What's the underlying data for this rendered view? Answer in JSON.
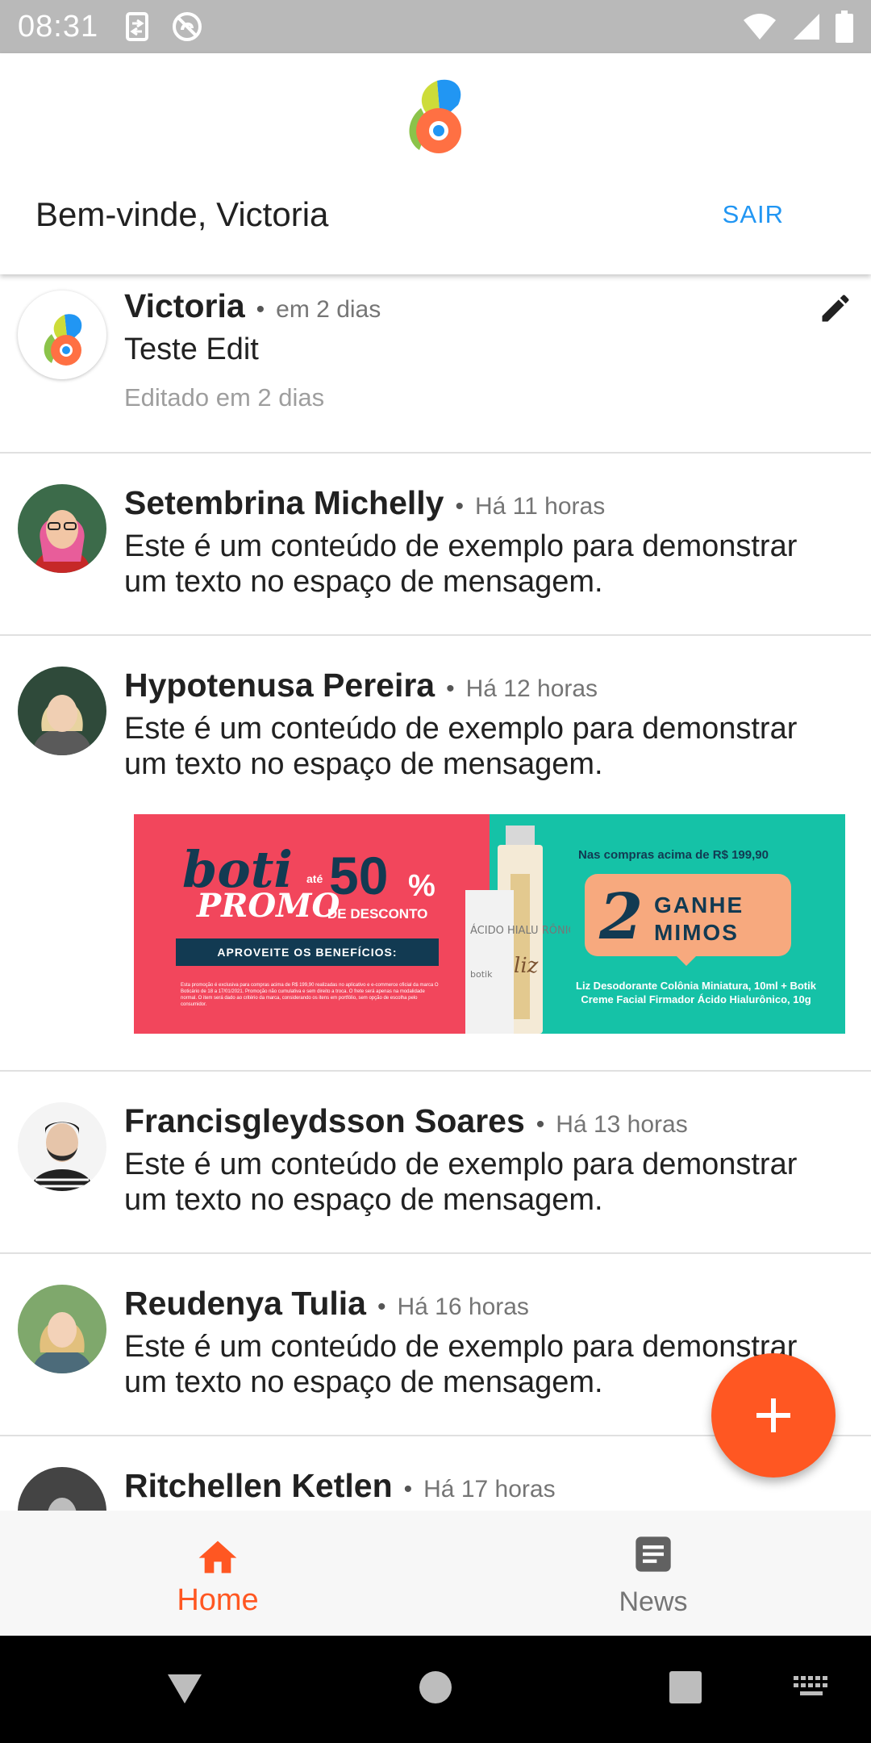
{
  "status_bar": {
    "time": "08:31"
  },
  "header": {
    "welcome": "Bem-vinde, Victoria",
    "logout_label": "SAIR"
  },
  "posts": [
    {
      "author": "Victoria",
      "time": "em 2 dias",
      "message": "Teste Edit",
      "edited": "Editado em 2 dias"
    },
    {
      "author": "Setembrina Michelly",
      "time": "Há 11 horas",
      "message": "Este é um conteúdo de exemplo para demonstrar um texto no espaço de mensagem."
    },
    {
      "author": "Hypotenusa Pereira",
      "time": "Há 12 horas",
      "message": "Este é um conteúdo de exemplo para demonstrar um texto no espaço de mensagem."
    },
    {
      "author": "Francisgleydsson Soares",
      "time": "Há 13 horas",
      "message": "Este é um conteúdo de exemplo para demonstrar um texto no espaço de mensagem."
    },
    {
      "author": "Reudenya Tulia",
      "time": "Há 16 horas",
      "message": "Este é um conteúdo de exemplo para demonstrar um texto no espaço de mensagem."
    },
    {
      "author": "Ritchellen Ketlen",
      "time": "Há 17 horas"
    }
  ],
  "banner": {
    "brand": "boti",
    "promo": "PROMO",
    "ate": "até",
    "discount": "50",
    "percent": "%",
    "desconto": "DE DESCONTO",
    "cta": "APROVEITE OS BENEFÍCIOS:",
    "fineprint": "Esta promoção é exclusiva para compras acima de R$ 199,90 realizadas no aplicativo e e-commerce oficial da marca O Boticário de 18 a 17/01/2021. Promoção não cumulativa e sem direito a troca. O frete será apenas na modalidade normal. O item será dado ao critério da marca, considerando os itens em portfólio, sem opção de escolha pelo consumidor.",
    "compras": "Nas compras acima de R$ 199,90",
    "gift_count": "2",
    "gift_text_1": "GANHE",
    "gift_text_2": "MIMOS",
    "gift_details": "Liz Desodorante Colônia Miniatura, 10ml + Botik Creme Facial Firmador Ácido Hialurônico, 10g",
    "product_label": "ÁCIDO HIALU RÔNICO",
    "product_brand_1": "botik",
    "product_brand_2": "liz"
  },
  "bottom_nav": {
    "home_label": "Home",
    "news_label": "News"
  },
  "colors": {
    "accent": "#ff5722",
    "link": "#2196f3",
    "status_bar": "#b9b9b9"
  },
  "icons": [
    "app-logo-icon",
    "edit-pencil-icon",
    "add-icon",
    "home-icon",
    "news-icon"
  ]
}
